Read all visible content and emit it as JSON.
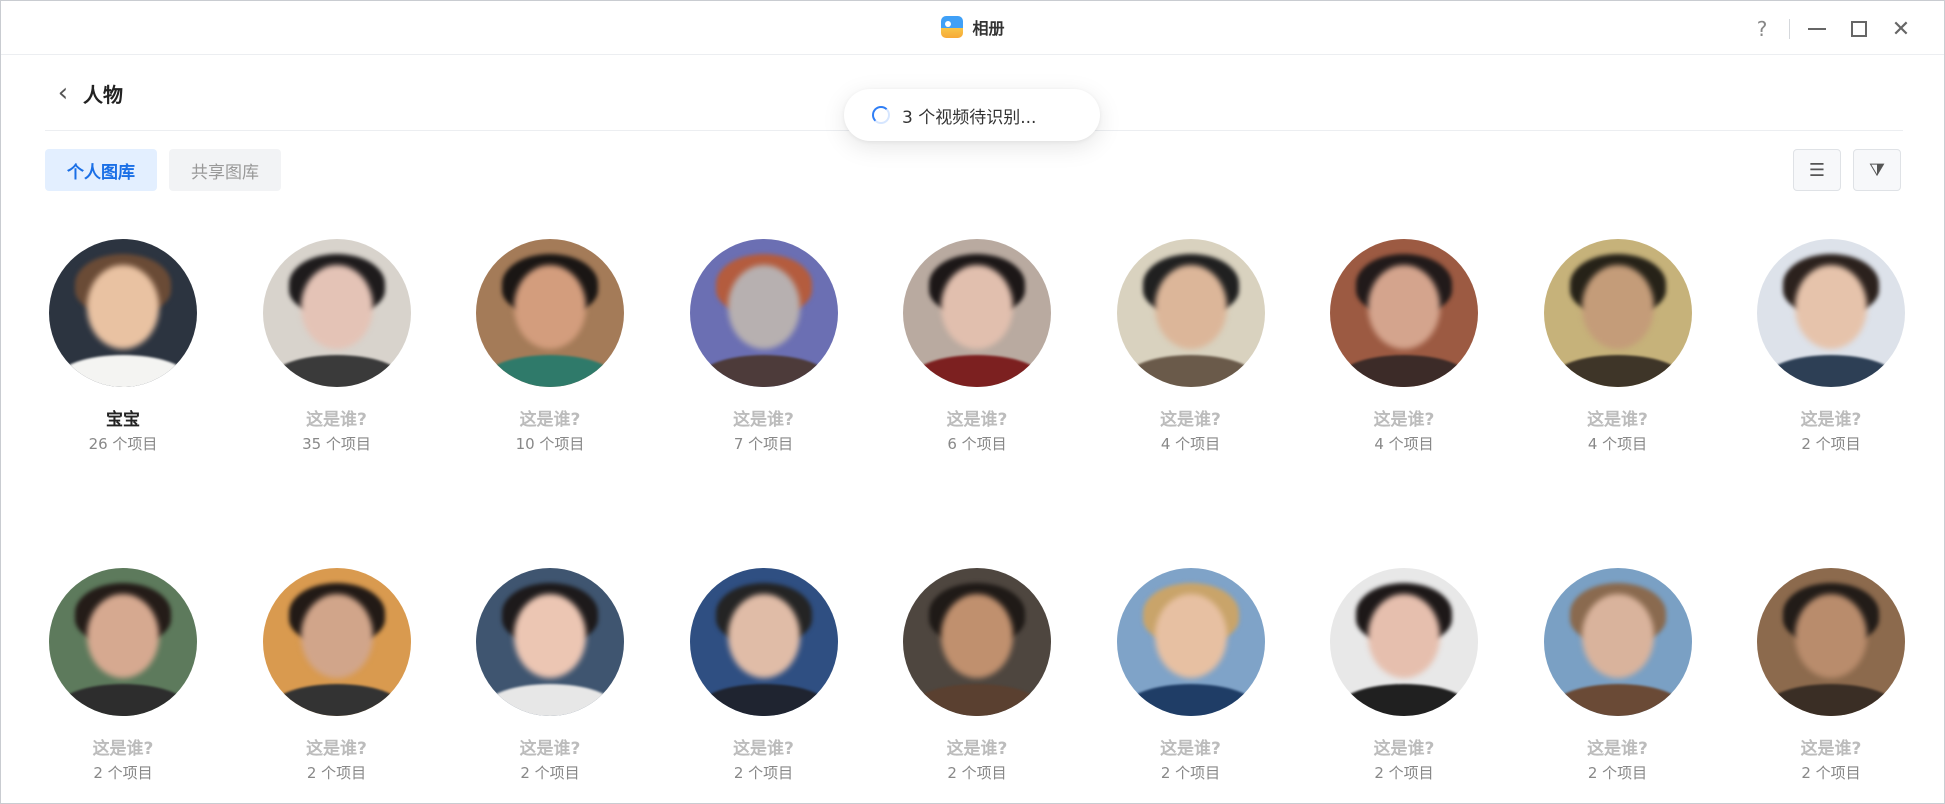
{
  "window": {
    "app_title": "相册",
    "help_glyph": "?",
    "close_glyph": "✕"
  },
  "header": {
    "back_glyph": "‹",
    "title": "人物"
  },
  "toast": {
    "text": "3 个视频待识别..."
  },
  "tabs": [
    {
      "label": "个人图库",
      "active": true
    },
    {
      "label": "共享图库",
      "active": false
    }
  ],
  "tools": {
    "sort_icon": "sort-icon",
    "filter_icon": "filter-icon",
    "sort_glyph": "☰",
    "filter_glyph": "⧩"
  },
  "people": [
    {
      "name": "宝宝",
      "count": "26 个项目",
      "named": true,
      "bg": "#2c3440",
      "face": "#e9c2a2",
      "hair": "#6a4b36",
      "body": "#f4f4f2"
    },
    {
      "name": "这是谁?",
      "count": "35 个项目",
      "named": false,
      "bg": "#d8d3cc",
      "face": "#e4c3b6",
      "hair": "#1e1b1c",
      "body": "#3a3a3a"
    },
    {
      "name": "这是谁?",
      "count": "10 个项目",
      "named": false,
      "bg": "#a47b58",
      "face": "#d39d7d",
      "hair": "#1a1614",
      "body": "#2f7a6a"
    },
    {
      "name": "这是谁?",
      "count": "7 个项目",
      "named": false,
      "bg": "#6b6fb3",
      "face": "#b7b0b0",
      "hair": "#b45c3e",
      "body": "#4d3b3a"
    },
    {
      "name": "这是谁?",
      "count": "6 个项目",
      "named": false,
      "bg": "#b9aaa0",
      "face": "#e1bfae",
      "hair": "#1c1717",
      "body": "#7c2020"
    },
    {
      "name": "这是谁?",
      "count": "4 个项目",
      "named": false,
      "bg": "#d9d2bf",
      "face": "#dcb699",
      "hair": "#202020",
      "body": "#6a5a4a"
    },
    {
      "name": "这是谁?",
      "count": "4 个项目",
      "named": false,
      "bg": "#9c5a42",
      "face": "#d4a48d",
      "hair": "#211a1a",
      "body": "#3c2b28"
    },
    {
      "name": "这是谁?",
      "count": "4 个项目",
      "named": false,
      "bg": "#c6b27a",
      "face": "#c49c79",
      "hair": "#262218",
      "body": "#3e3528"
    },
    {
      "name": "这是谁?",
      "count": "2 个项目",
      "named": false,
      "bg": "#dde2ea",
      "face": "#e6c3ab",
      "hair": "#2b211d",
      "body": "#2d3f55"
    },
    {
      "name": "这是谁?",
      "count": "2 个项目",
      "named": false,
      "bg": "#5d7a5c",
      "face": "#d6a990",
      "hair": "#241c18",
      "body": "#2d2d2d"
    },
    {
      "name": "这是谁?",
      "count": "2 个项目",
      "named": false,
      "bg": "#d99a4f",
      "face": "#d1a58a",
      "hair": "#221a16",
      "body": "#333333"
    },
    {
      "name": "这是谁?",
      "count": "2 个项目",
      "named": false,
      "bg": "#3f5570",
      "face": "#ecc6b3",
      "hair": "#1d1a1b",
      "body": "#e7e7e7"
    },
    {
      "name": "这是谁?",
      "count": "2 个项目",
      "named": false,
      "bg": "#2f4f82",
      "face": "#e0bca7",
      "hair": "#242424",
      "body": "#1f2430"
    },
    {
      "name": "这是谁?",
      "count": "2 个项目",
      "named": false,
      "bg": "#4e463f",
      "face": "#c0906e",
      "hair": "#1f1a17",
      "body": "#5a4030"
    },
    {
      "name": "这是谁?",
      "count": "2 个项目",
      "named": false,
      "bg": "#7fa3c8",
      "face": "#e7c0a2",
      "hair": "#c9a46a",
      "body": "#1f3d66"
    },
    {
      "name": "这是谁?",
      "count": "2 个项目",
      "named": false,
      "bg": "#e8e8e8",
      "face": "#e6bfae",
      "hair": "#1d1818",
      "body": "#202020"
    },
    {
      "name": "这是谁?",
      "count": "2 个项目",
      "named": false,
      "bg": "#7aa0c4",
      "face": "#d9b39c",
      "hair": "#8a6a4f",
      "body": "#6a4a36"
    },
    {
      "name": "这是谁?",
      "count": "2 个项目",
      "named": false,
      "bg": "#8c6a4d",
      "face": "#b98c6c",
      "hair": "#221c18",
      "body": "#3a2e25"
    }
  ]
}
